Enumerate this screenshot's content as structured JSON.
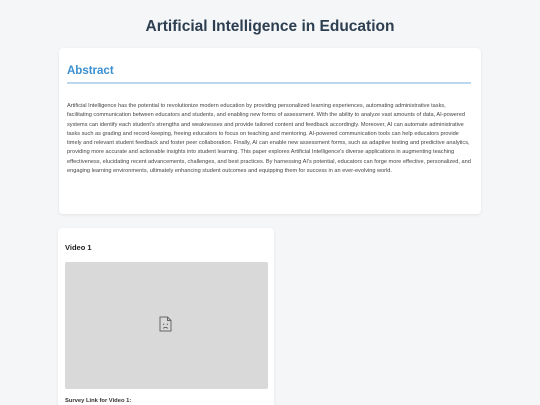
{
  "page": {
    "title": "Artificial Intelligence in Education"
  },
  "abstract": {
    "heading": "Abstract",
    "text": "Artificial Intelligence has the potential to revolutionize modern education by providing personalized learning experiences, automating administrative tasks, facilitating communication between educators and students, and enabling new forms of assessment. With the ability to analyze vast amounts of data, AI-powered systems can identify each student's strengths and weaknesses and provide tailored content and feedback accordingly. Moreover, AI can automate administrative tasks such as grading and record-keeping, freeing educators to focus on teaching and mentoring. AI-powered communication tools can help educators provide timely and relevant student feedback and foster peer collaboration. Finally, AI can enable new assessment forms, such as adaptive testing and predictive analytics, providing more accurate and actionable insights into student learning. This paper explores Artificial Intelligence's diverse applications in augmenting teaching effectiveness, elucidating recent advancements, challenges, and best practices. By harnessing AI's potential, educators can forge more effective, personalized, and engaging learning environments, ultimately enhancing student outcomes and equipping them for success in an ever-evolving world."
  },
  "video1": {
    "title": "Video 1",
    "icon": "broken-image-icon",
    "survey_label": "Survey Link for Video 1:"
  },
  "colors": {
    "background": "#f4f6f8",
    "title": "#2c3e50",
    "accent": "#3a8fd0",
    "video_placeholder": "#d9d9d9"
  }
}
